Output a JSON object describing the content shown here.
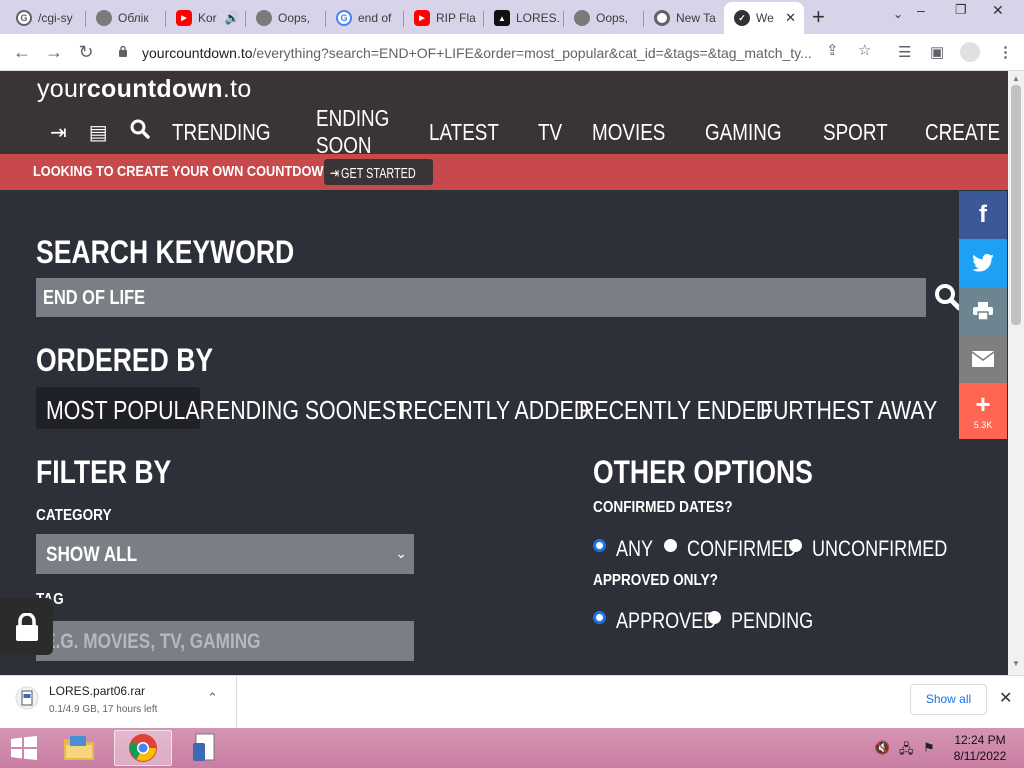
{
  "browser": {
    "tabs": [
      {
        "label": "/cgi-sy",
        "fav_color": "#5f6368",
        "fav_glyph": "G"
      },
      {
        "label": "Облік",
        "fav_color": "#5f6368",
        "fav_glyph": ""
      },
      {
        "label": "Kor",
        "fav_color": "#ff0000",
        "fav_glyph": "▶"
      },
      {
        "label": "Oops, ",
        "fav_color": "#5f6368",
        "fav_glyph": ""
      },
      {
        "label": "end of",
        "fav_color": "#4285f4",
        "fav_glyph": "G"
      },
      {
        "label": "RIP Fla",
        "fav_color": "#ff0000",
        "fav_glyph": "▶"
      },
      {
        "label": "LORES.",
        "fav_color": "#111111",
        "fav_glyph": "▲"
      },
      {
        "label": "Oops, ",
        "fav_color": "#5f6368",
        "fav_glyph": ""
      },
      {
        "label": "New Ta",
        "fav_color": "#5f6368",
        "fav_glyph": ""
      },
      {
        "label": "We",
        "fav_color": "#333333",
        "fav_glyph": "✓"
      }
    ],
    "url_host": "yourcountdown.to",
    "url_path": "/everything?search=END+OF+LIFE&order=most_popular&cat_id=&tags=&tag_match_ty..."
  },
  "site": {
    "logo_your": "your",
    "logo_countdown": "countdown",
    "logo_tld": ".to",
    "nav": [
      "TRENDING",
      "ENDING SOON",
      "LATEST",
      "TV",
      "MOVIES",
      "GAMING",
      "SPORT",
      "CREATE"
    ],
    "promo_text": "LOOKING TO CREATE YOUR OWN COUNTDOWN?",
    "promo_button": "GET STARTED"
  },
  "search": {
    "heading": "SEARCH KEYWORD",
    "value": "END OF LIFE"
  },
  "order": {
    "heading": "ORDERED BY",
    "options": [
      "MOST POPULAR",
      "ENDING SOONEST",
      "RECENTLY ADDED",
      "RECENTLY ENDED",
      "FURTHEST AWAY"
    ],
    "selected": "MOST POPULAR"
  },
  "filter": {
    "heading": "FILTER BY",
    "category_label": "CATEGORY",
    "category_value": "SHOW ALL",
    "tag_label": "TAG",
    "tag_placeholder": "E.G. MOVIES, TV, GAMING"
  },
  "other": {
    "heading": "OTHER OPTIONS",
    "confirmed_label": "CONFIRMED DATES?",
    "confirmed_options": [
      "ANY",
      "CONFIRMED",
      "UNCONFIRMED"
    ],
    "confirmed_selected": "ANY",
    "approved_label": "APPROVED ONLY?",
    "approved_options": [
      "APPROVED",
      "PENDING"
    ],
    "approved_selected": "APPROVED"
  },
  "share": {
    "more_count": "5.3K",
    "colors": {
      "facebook": "#3b5998",
      "twitter": "#1da1f2",
      "print": "#6d8590",
      "email": "#7f7f7f",
      "more": "#ff6550"
    }
  },
  "downloads": {
    "file_name": "LORES.part06.rar",
    "status": "0.1/4.9 GB, 17 hours left",
    "show_all": "Show all"
  },
  "taskbar": {
    "time": "12:24 PM",
    "date": "8/11/2022"
  },
  "colors": {
    "page_bg": "#2d3038",
    "header_bg": "#3a3434",
    "promo_bg": "#c8494b",
    "input_bg": "#7b7e85"
  }
}
